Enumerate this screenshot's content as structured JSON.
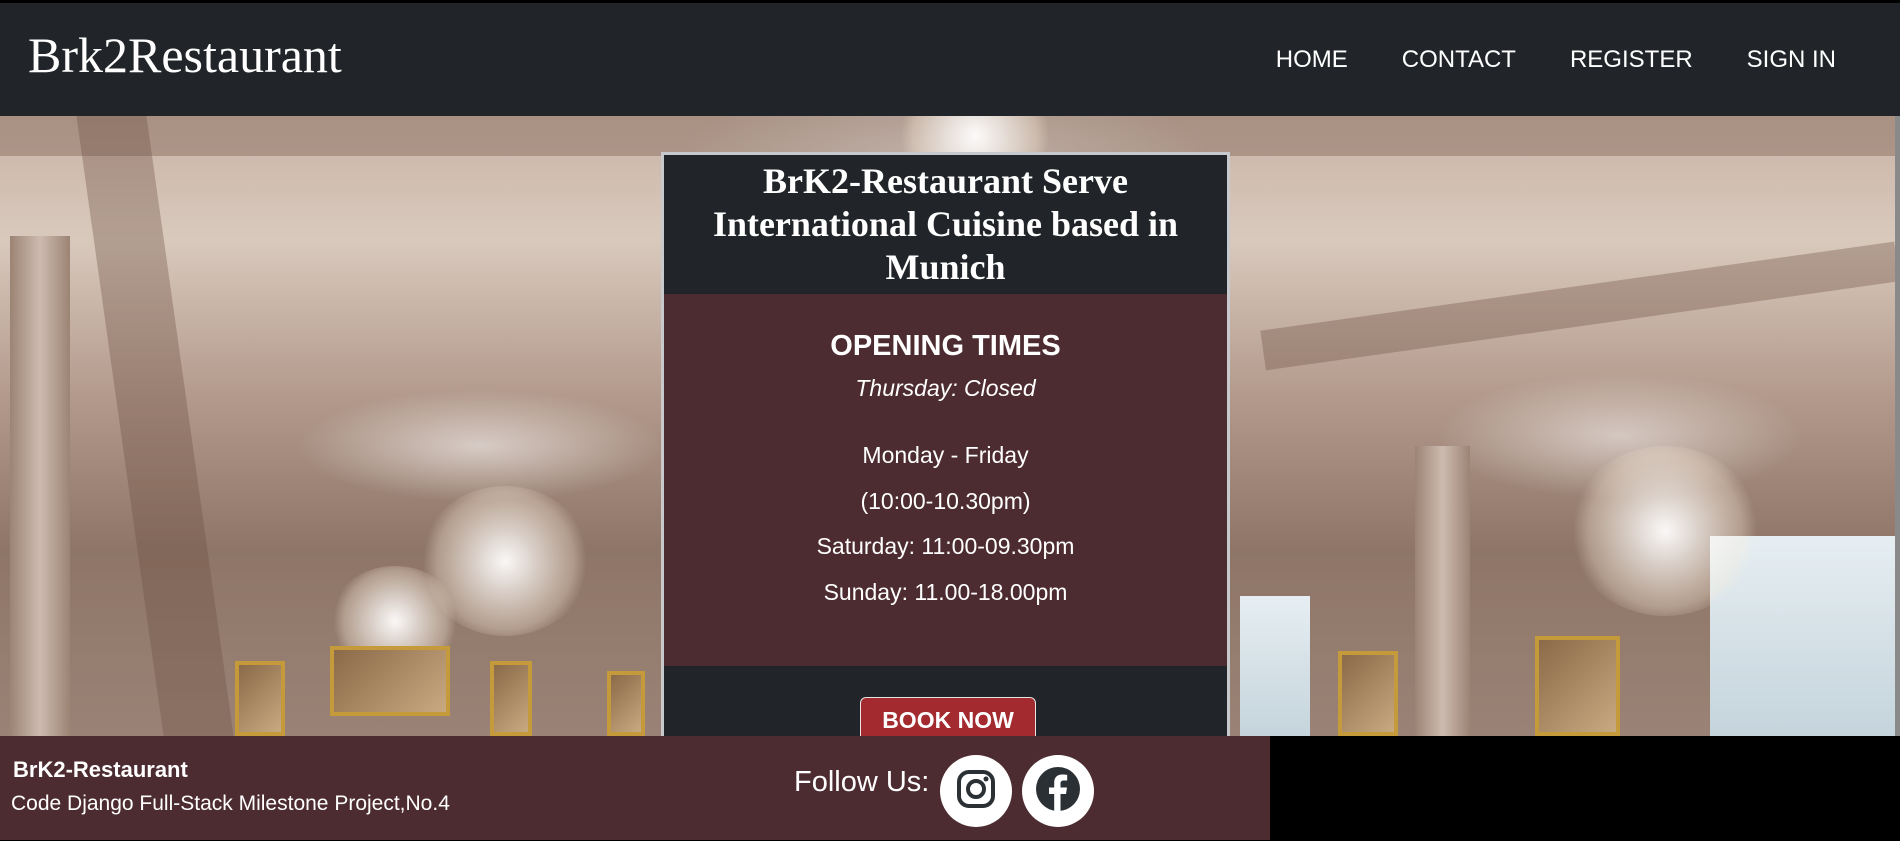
{
  "navbar": {
    "brand": "Brk2Restaurant",
    "links": [
      "HOME",
      "CONTACT",
      "REGISTER",
      "SIGN IN"
    ]
  },
  "card": {
    "title": "BrK2-Restaurant Serve International Cuisine based in Munich",
    "hours_title": "OPENING TIMES",
    "closed_note": "Thursday: Closed",
    "hours": [
      "Monday - Friday",
      "(10:00-10.30pm)",
      "Saturday: 11:00-09.30pm",
      "Sunday: 11.00-18.00pm"
    ],
    "book_button": "BOOK NOW"
  },
  "footer": {
    "name": "BrK2-Restaurant",
    "subtitle": "Code Django Full-Stack Milestone Project,No.4",
    "follow_label": "Follow Us:",
    "socials": [
      "instagram-icon",
      "facebook-icon"
    ]
  },
  "colors": {
    "navbar_bg": "#212529",
    "card_body_bg": "#4c2c30",
    "footer_bg": "#4c2c30",
    "book_button_bg": "#a32a2f"
  }
}
